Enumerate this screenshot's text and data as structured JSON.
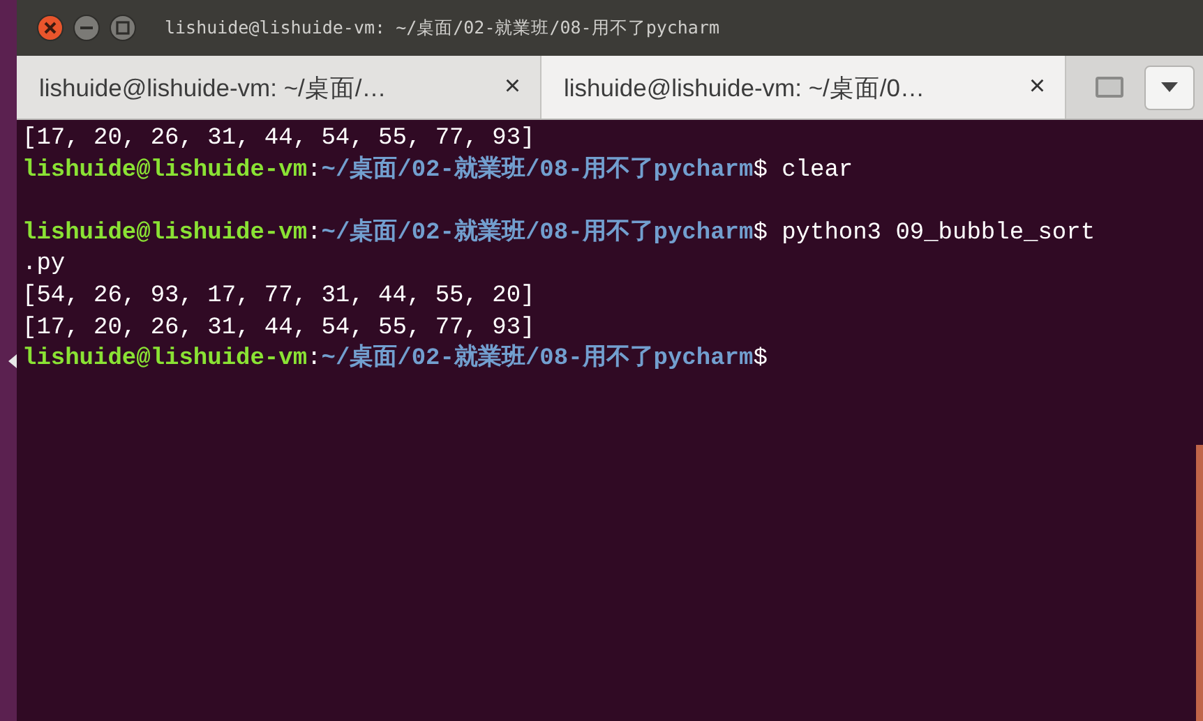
{
  "window": {
    "title": "lishuide@lishuide-vm: ~/桌面/02-就業班/08-用不了pycharm"
  },
  "tabs": [
    {
      "label": "lishuide@lishuide-vm:  ~/桌面/…",
      "close": "×",
      "selected": false
    },
    {
      "label": "lishuide@lishuide-vm:  ~/桌面/0…",
      "close": "×",
      "selected": true
    }
  ],
  "terminal": {
    "lines": [
      {
        "kind": "output",
        "text": "[17, 20, 26, 31, 44, 54, 55, 77, 93]"
      },
      {
        "kind": "prompt",
        "user": "lishuide@lishuide-vm",
        "sep": ":",
        "path": "~/桌面/02-就業班/08-用不了pycharm",
        "symbol": "$",
        "command": " clear"
      },
      {
        "kind": "blank"
      },
      {
        "kind": "prompt",
        "user": "lishuide@lishuide-vm",
        "sep": ":",
        "path": "~/桌面/02-就業班/08-用不了pycharm",
        "symbol": "$",
        "command": " python3 09_bubble_sort"
      },
      {
        "kind": "output",
        "text": ".py"
      },
      {
        "kind": "output",
        "text": "[54, 26, 93, 17, 77, 31, 44, 55, 20]"
      },
      {
        "kind": "output",
        "text": "[17, 20, 26, 31, 44, 54, 55, 77, 93]"
      },
      {
        "kind": "prompt",
        "user": "lishuide@lishuide-vm",
        "sep": ":",
        "path": "~/桌面/02-就業班/08-用不了pycharm",
        "symbol": "$"
      }
    ]
  }
}
